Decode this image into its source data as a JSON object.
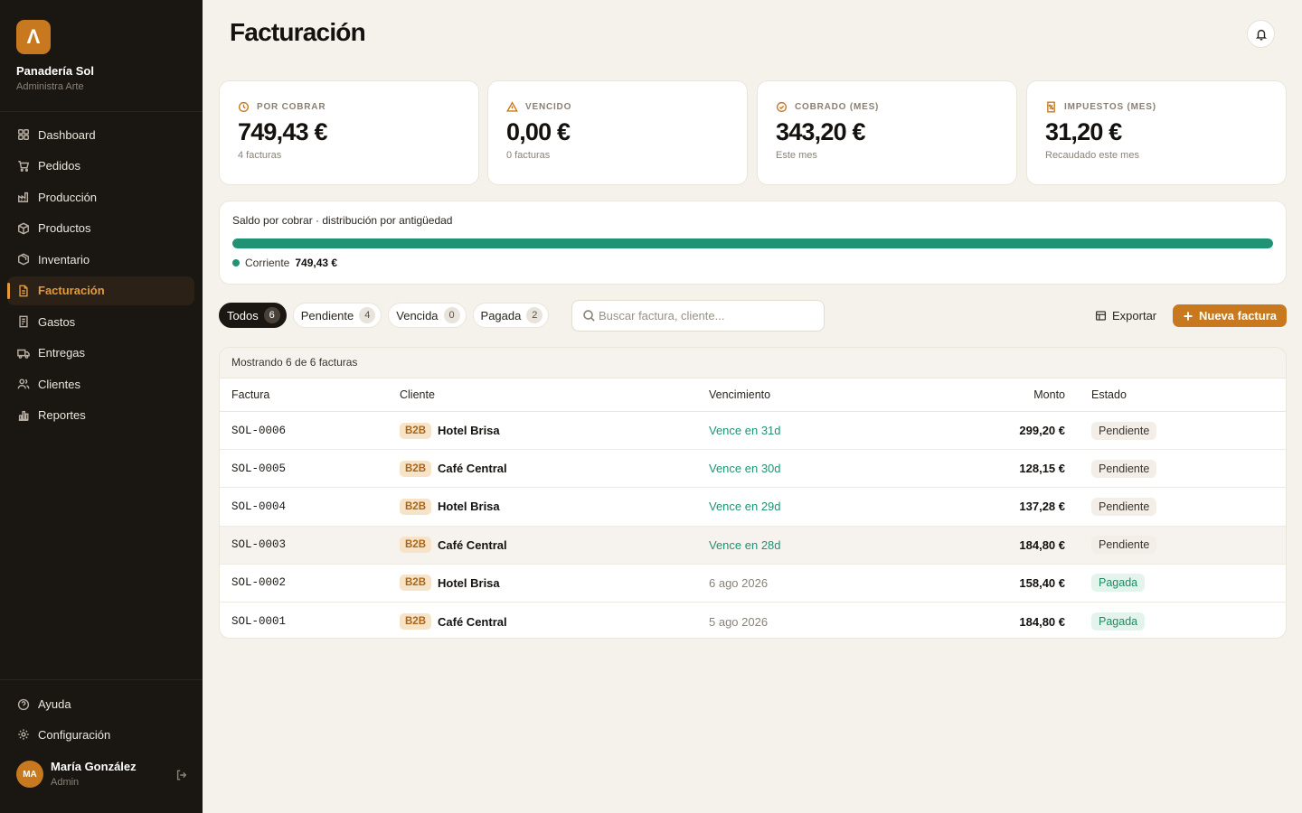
{
  "brand": {
    "logo_letter": "Λ",
    "name": "Panadería Sol",
    "subtitle": "Administra Arte"
  },
  "nav": [
    {
      "label": "Dashboard",
      "icon": "grid-icon",
      "active": false
    },
    {
      "label": "Pedidos",
      "icon": "cart-icon",
      "active": false
    },
    {
      "label": "Producción",
      "icon": "factory-icon",
      "active": false
    },
    {
      "label": "Productos",
      "icon": "box-icon",
      "active": false
    },
    {
      "label": "Inventario",
      "icon": "package-icon",
      "active": false
    },
    {
      "label": "Facturación",
      "icon": "invoice-icon",
      "active": true
    },
    {
      "label": "Gastos",
      "icon": "receipt-icon",
      "active": false
    },
    {
      "label": "Entregas",
      "icon": "truck-icon",
      "active": false
    },
    {
      "label": "Clientes",
      "icon": "users-icon",
      "active": false
    },
    {
      "label": "Reportes",
      "icon": "bar-chart-icon",
      "active": false
    }
  ],
  "bottom_nav": [
    {
      "label": "Ayuda",
      "icon": "help-icon"
    },
    {
      "label": "Configuración",
      "icon": "gear-icon"
    }
  ],
  "user": {
    "initials": "MA",
    "name": "María González",
    "role": "Admin"
  },
  "page": {
    "title": "Facturación"
  },
  "stats": [
    {
      "label": "Por cobrar",
      "value": "749,43 €",
      "sub": "4 facturas",
      "icon": "coin-clock-icon"
    },
    {
      "label": "Vencido",
      "value": "0,00 €",
      "sub": "0 facturas",
      "icon": "warning-icon"
    },
    {
      "label": "Cobrado (mes)",
      "value": "343,20 €",
      "sub": "Este mes",
      "icon": "check-circle-icon"
    },
    {
      "label": "Impuestos (mes)",
      "value": "31,20 €",
      "sub": "Recaudado este mes",
      "icon": "tax-receipt-icon"
    }
  ],
  "aging": {
    "title": "Saldo por cobrar · distribución por antigüedad",
    "current_fraction": 1.0,
    "legend_label": "Corriente",
    "legend_value": "749,43 €",
    "color": "#1f9374"
  },
  "filters": [
    {
      "label": "Todos",
      "count": "6",
      "active": true
    },
    {
      "label": "Pendiente",
      "count": "4",
      "active": false
    },
    {
      "label": "Vencida",
      "count": "0",
      "active": false
    },
    {
      "label": "Pagada",
      "count": "2",
      "active": false
    }
  ],
  "search": {
    "placeholder": "Buscar factura, cliente...",
    "value": ""
  },
  "toolbar": {
    "export_label": "Exportar",
    "new_label": "Nueva factura"
  },
  "table": {
    "caption": "Mostrando 6 de 6 facturas",
    "columns": [
      "Factura",
      "Cliente",
      "Vencimiento",
      "Monto",
      "Estado"
    ],
    "rows": [
      {
        "id": "SOL-0006",
        "tag": "B2B",
        "client": "Hotel Brisa",
        "due": "Vence en 31d",
        "due_type": "soon",
        "amount": "299,20 €",
        "state": "Pendiente",
        "state_type": "pend"
      },
      {
        "id": "SOL-0005",
        "tag": "B2B",
        "client": "Café Central",
        "due": "Vence en 30d",
        "due_type": "soon",
        "amount": "128,15 €",
        "state": "Pendiente",
        "state_type": "pend"
      },
      {
        "id": "SOL-0004",
        "tag": "B2B",
        "client": "Hotel Brisa",
        "due": "Vence en 29d",
        "due_type": "soon",
        "amount": "137,28 €",
        "state": "Pendiente",
        "state_type": "pend"
      },
      {
        "id": "SOL-0003",
        "tag": "B2B",
        "client": "Café Central",
        "due": "Vence en 28d",
        "due_type": "soon",
        "amount": "184,80 €",
        "state": "Pendiente",
        "state_type": "pend"
      },
      {
        "id": "SOL-0002",
        "tag": "B2B",
        "client": "Hotel Brisa",
        "due": "6 ago 2026",
        "due_type": "date",
        "amount": "158,40 €",
        "state": "Pagada",
        "state_type": "paid"
      },
      {
        "id": "SOL-0001",
        "tag": "B2B",
        "client": "Café Central",
        "due": "5 ago 2026",
        "due_type": "date",
        "amount": "184,80 €",
        "state": "Pagada",
        "state_type": "paid"
      }
    ]
  },
  "colors": {
    "accent": "#c8791f",
    "sidebar": "#1a1612",
    "success": "#1f9374",
    "background": "#f5f2ec"
  }
}
